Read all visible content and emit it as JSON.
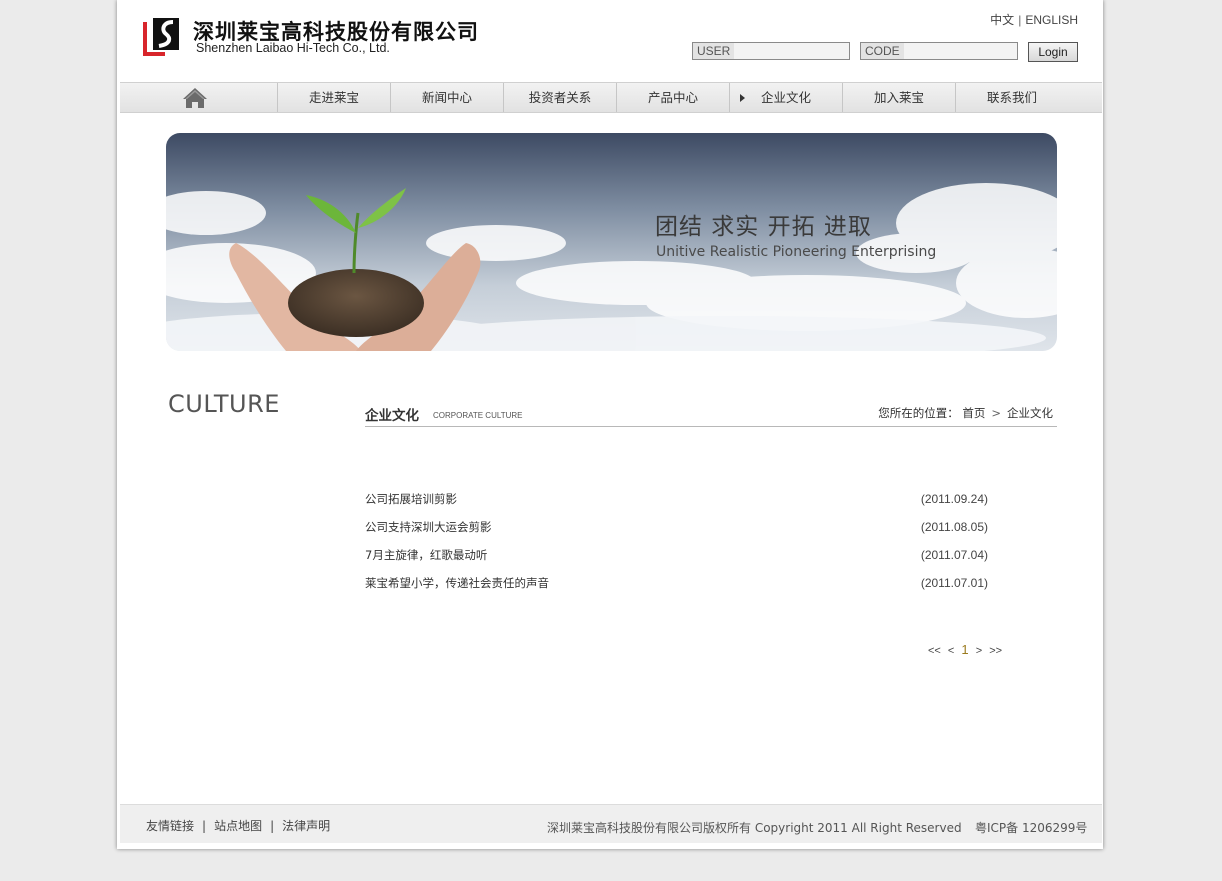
{
  "header": {
    "company_cn": "深圳莱宝高科技股份有限公司",
    "company_en": "Shenzhen Laibao Hi-Tech Co., Ltd.",
    "lang_cn": "中文",
    "lang_sep": "|",
    "lang_en": "ENGLISH",
    "user_label": "USER",
    "code_label": "CODE",
    "login_button": "Login"
  },
  "nav": {
    "items": [
      "走进莱宝",
      "新闻中心",
      "投资者关系",
      "产品中心",
      "企业文化",
      "加入莱宝",
      "联系我们"
    ],
    "active": "企业文化"
  },
  "banner": {
    "slogan_cn": "团结  求实  开拓  进取",
    "slogan_en": "Unitive Realistic Pioneering Enterprising"
  },
  "sidebar": {
    "title": "CULTURE"
  },
  "section": {
    "title": "企业文化",
    "subtitle": "CORPORATE CULTURE",
    "breadcrumb_label": "您所在的位置：",
    "breadcrumb_home": "首页",
    "breadcrumb_arrow": ">",
    "breadcrumb_current": "企业文化"
  },
  "news": [
    {
      "title": "公司拓展培训剪影",
      "date": "(2011.09.24)"
    },
    {
      "title": "公司支持深圳大运会剪影",
      "date": "(2011.08.05)"
    },
    {
      "title": "7月主旋律，红歌最动听",
      "date": "(2011.07.04)"
    },
    {
      "title": "莱宝希望小学，传递社会责任的声音",
      "date": "(2011.07.01)"
    }
  ],
  "pager": {
    "first": "<<",
    "prev": "<",
    "current": "1",
    "next": ">",
    "last": ">>"
  },
  "footer": {
    "links": [
      "友情链接",
      "站点地图",
      "法律声明"
    ],
    "sep": "|",
    "copyright": "深圳莱宝高科技股份有限公司版权所有 Copyright 2011 All Right Reserved",
    "icp": "粤ICP备 1206299号"
  },
  "colors": {
    "accent_red": "#d8252b",
    "page_bg": "#ebebeb",
    "nav_bg": "#e8e8e8",
    "sky_top": "#3d4a63"
  }
}
